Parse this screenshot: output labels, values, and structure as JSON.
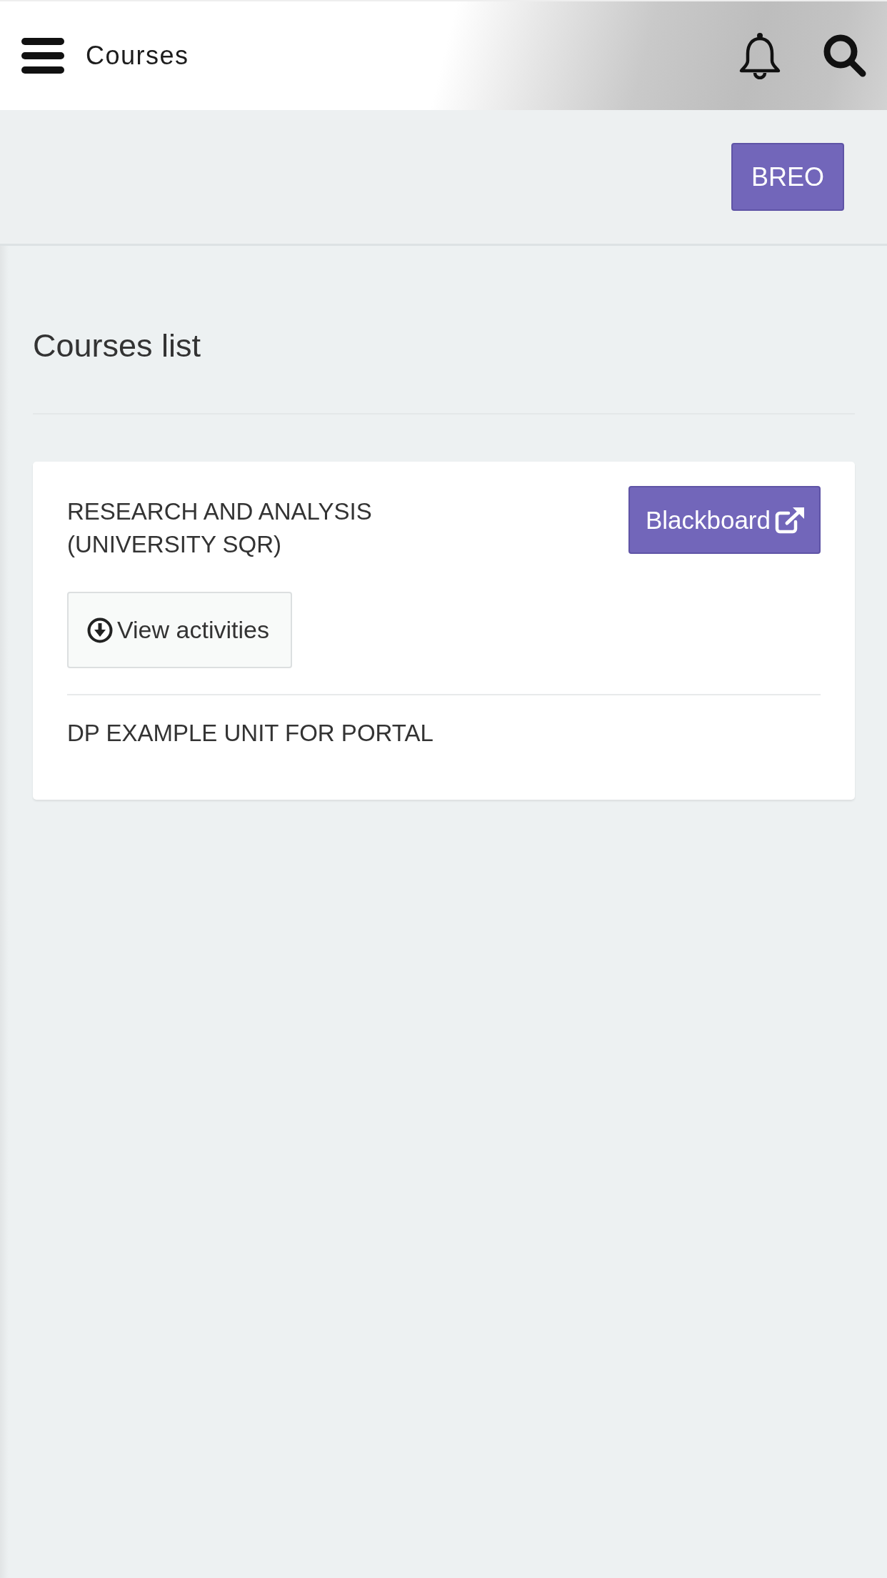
{
  "header": {
    "title": "Courses"
  },
  "toolbar": {
    "buttons": [
      {
        "label": "BREO"
      }
    ]
  },
  "page": {
    "heading": "Courses list"
  },
  "courses": [
    {
      "title": "RESEARCH AND ANALYSIS (UNIVERSITY SQR)",
      "link": {
        "label": "Blackboard"
      },
      "actions": [
        {
          "label": "View activities"
        }
      ]
    },
    {
      "title": "DP EXAMPLE UNIT FOR PORTAL"
    }
  ]
}
